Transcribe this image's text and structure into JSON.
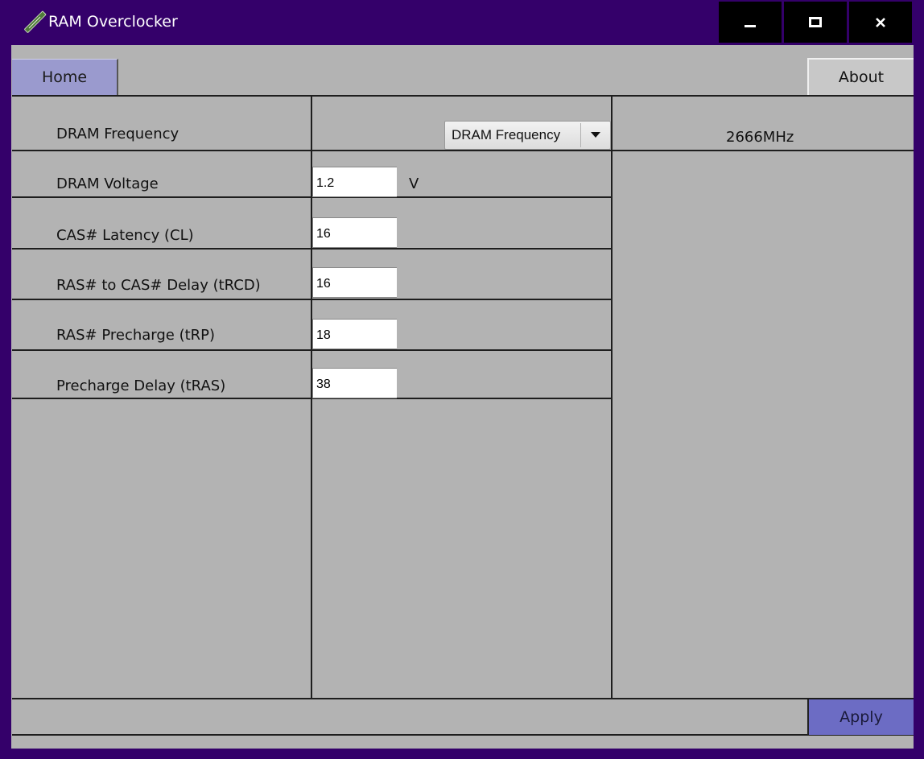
{
  "window": {
    "title": "RAM Overclocker",
    "icon": "ram-stick-icon"
  },
  "tabs": {
    "home": "Home",
    "about": "About"
  },
  "settings": {
    "frequency": {
      "label": "DRAM Frequency",
      "dropdown_selected": "DRAM Frequency",
      "value": "2666MHz"
    },
    "voltage": {
      "label": "DRAM Voltage",
      "value": "1.2",
      "unit": "V"
    },
    "cas_latency": {
      "label": "CAS# Latency (CL)",
      "value": "16"
    },
    "trcd": {
      "label": "RAS# to CAS# Delay (tRCD)",
      "value": "16"
    },
    "trp": {
      "label": "RAS# Precharge (tRP)",
      "value": "18"
    },
    "tras": {
      "label": "Precharge Delay (tRAS)",
      "value": "38"
    }
  },
  "footer": {
    "apply_label": "Apply"
  },
  "colors": {
    "titlebar": "#34006a",
    "panel": "#b3b3b3",
    "home_tab": "#9a9ace",
    "apply_button": "#6c6cc4"
  }
}
